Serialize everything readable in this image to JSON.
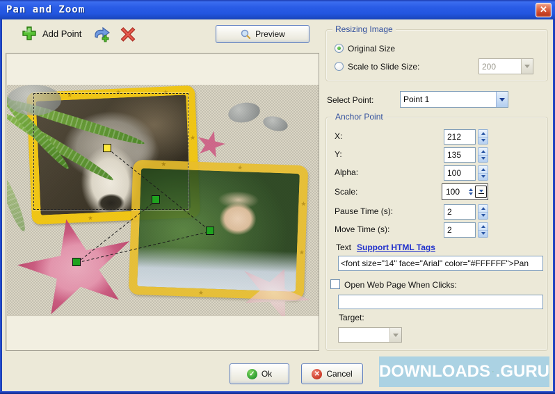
{
  "window": {
    "title": "Pan and Zoom",
    "close_glyph": "✕"
  },
  "toolbar": {
    "add_point_label": "Add Point",
    "preview_label": "Preview"
  },
  "resizing": {
    "title": "Resizing Image",
    "original_label": "Original Size",
    "scale_label": "Scale to Slide Size:",
    "scale_value": "200"
  },
  "select_point": {
    "label": "Select Point:",
    "value": "Point 1"
  },
  "anchor": {
    "title": "Anchor Point",
    "rows": [
      {
        "label": "X:",
        "value": "212"
      },
      {
        "label": "Y:",
        "value": "135"
      },
      {
        "label": "Alpha:",
        "value": "100"
      },
      {
        "label": "Scale:",
        "value": "100"
      },
      {
        "label": "Pause Time (s):",
        "value": "2"
      },
      {
        "label": "Move Time (s):",
        "value": "2"
      }
    ],
    "text_label": "Text",
    "html_link": "Support HTML Tags",
    "text_value": "<font size=\"14\" face=\"Arial\" color=\"#FFFFFF\">Pan",
    "open_web_label": "Open Web Page When Clicks:",
    "url_value": "",
    "target_label": "Target:",
    "target_value": ""
  },
  "buttons": {
    "ok": "Ok",
    "cancel": "Cancel",
    "ok_glyph": "✓",
    "cancel_glyph": "✕"
  },
  "watermark": {
    "left": "DOWNLOADS",
    "right": ".GURU"
  },
  "colors": {
    "titlebar_blue": "#2a5ce6",
    "selected_marker": "#ffe93c",
    "anchor_marker": "#1fa31f",
    "frame_yellow": "#f2c50a",
    "starfish_pink": "#c9537b",
    "group_title_blue": "#33519e",
    "watermark_bg": "#a4cfe4"
  }
}
